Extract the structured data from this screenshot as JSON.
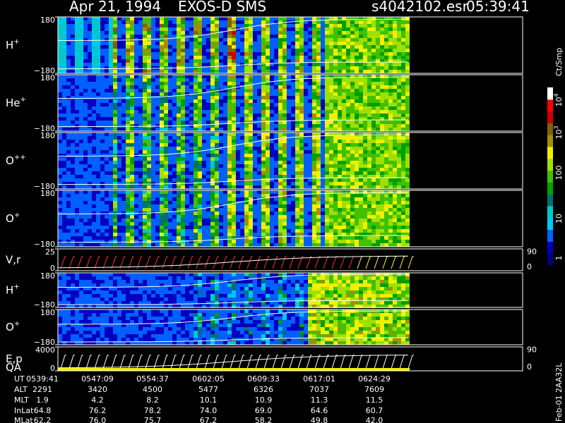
{
  "header": {
    "date": "Apr 21, 1994",
    "instrument": "EXOS-D SMS",
    "file": "s4042102.esr",
    "time": "05:39:41"
  },
  "colorbar": {
    "unit": "Ct/Smp",
    "ticks": [
      "1",
      "10",
      "100",
      "10",
      "10"
    ],
    "tick_exponents": [
      "",
      "",
      "",
      "3",
      "4"
    ],
    "colors_low_to_high": [
      "#000080",
      "#0000c0",
      "#0060ff",
      "#00c8ff",
      "#00c8c8",
      "#007070",
      "#00a000",
      "#40c000",
      "#a0e000",
      "#f0f000",
      "#a09000",
      "#806000",
      "#c80000",
      "#ff0000",
      "#ffffff"
    ]
  },
  "side_label": "Feb-01 2AA32L",
  "chart_data": {
    "type": "heatmap",
    "panels": [
      {
        "id": "h-plus-1",
        "label": "H",
        "sup": "+",
        "ytop": "180",
        "ybot": "−180",
        "ylim": [
          -180,
          180
        ]
      },
      {
        "id": "he-plus",
        "label": "He",
        "sup": "+",
        "ytop": "180",
        "ybot": "−180",
        "ylim": [
          -180,
          180
        ]
      },
      {
        "id": "o-plus-plus",
        "label": "O",
        "sup": "++",
        "ytop": "180",
        "ybot": "−180",
        "ylim": [
          -180,
          180
        ]
      },
      {
        "id": "o-plus-1",
        "label": "O",
        "sup": "+",
        "ytop": "180",
        "ybot": "−180",
        "ylim": [
          -180,
          180
        ]
      },
      {
        "id": "v-r",
        "label": "V,r",
        "sup": "",
        "ytop": "25",
        "ybot": "0",
        "right_top": "90",
        "right_bot": "0",
        "type": "line"
      },
      {
        "id": "h-plus-2",
        "label": "H",
        "sup": "+",
        "ytop": "180",
        "ybot": "−180",
        "ylim": [
          -180,
          180
        ]
      },
      {
        "id": "o-plus-2",
        "label": "O",
        "sup": "+",
        "ytop": "180",
        "ybot": "−180",
        "ylim": [
          -180,
          180
        ]
      },
      {
        "id": "e-p-qa",
        "label": "E,p",
        "label2": "QA",
        "sup": "",
        "ytop": "4000",
        "ybot": "0",
        "right_top": "90",
        "right_bot": "0",
        "type": "line"
      }
    ],
    "x_range": [
      "05:39:41",
      "06:24:29"
    ]
  },
  "orbit": {
    "rows": [
      {
        "label": "UT",
        "values": [
          "0539:41",
          "0547:09",
          "0554:37",
          "0602:05",
          "0609:33",
          "0617:01",
          "0624:29"
        ]
      },
      {
        "label": "ALT",
        "values": [
          "2291",
          "3420",
          "4500",
          "5477",
          "6326",
          "7037",
          "7609"
        ]
      },
      {
        "label": "MLT",
        "values": [
          "1.9",
          "4.2",
          "8.2",
          "10.1",
          "10.9",
          "11.3",
          "11.5"
        ]
      },
      {
        "label": "InLat",
        "values": [
          "64.8",
          "76.2",
          "78.2",
          "74.0",
          "69.0",
          "64.6",
          "60.7"
        ]
      },
      {
        "label": "MLat",
        "values": [
          "62.2",
          "76.0",
          "75.7",
          "67.2",
          "58.2",
          "49.8",
          "42.0"
        ]
      }
    ]
  }
}
